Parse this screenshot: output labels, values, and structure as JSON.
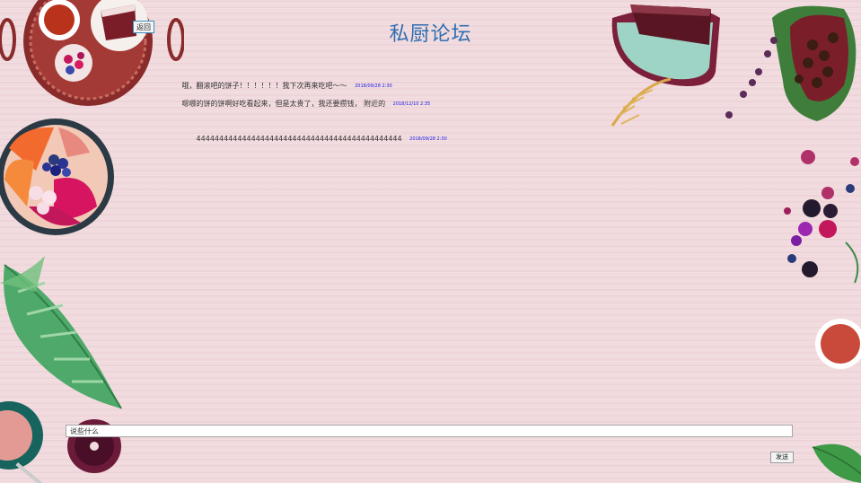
{
  "header": {
    "title": "私厨论坛",
    "back_label": "返回"
  },
  "posts": [
    {
      "user": "",
      "content": "哦，翻滚吧的饼子！！！！！！我下次再来吃吧～～",
      "date": "2018/09/28  2:30"
    },
    {
      "user": "",
      "content": "嗯哪的饼的饼啊好吃看起来，但是太贵了，我还要攒钱，  附近的",
      "date": "2018/12/10  2:35"
    },
    {
      "user": "",
      "content": "444444444444444444444444444444444444444444444",
      "date": "2018/09/28  2:30"
    }
  ],
  "reply": {
    "placeholder": "说些什么"
  },
  "submit_label": "发送",
  "colors": {
    "background": "#f1dade",
    "title": "#2f6fb3",
    "date": "#1a1ae6",
    "button_border": "#3e8fc2"
  },
  "decorations": [
    "basket-with-tea-and-cake",
    "fruit-bowl",
    "tropical-leaf",
    "tea-cup",
    "cake-plate",
    "coffee-beans-pod",
    "berries",
    "tea-cup-right",
    "green-leaf"
  ]
}
